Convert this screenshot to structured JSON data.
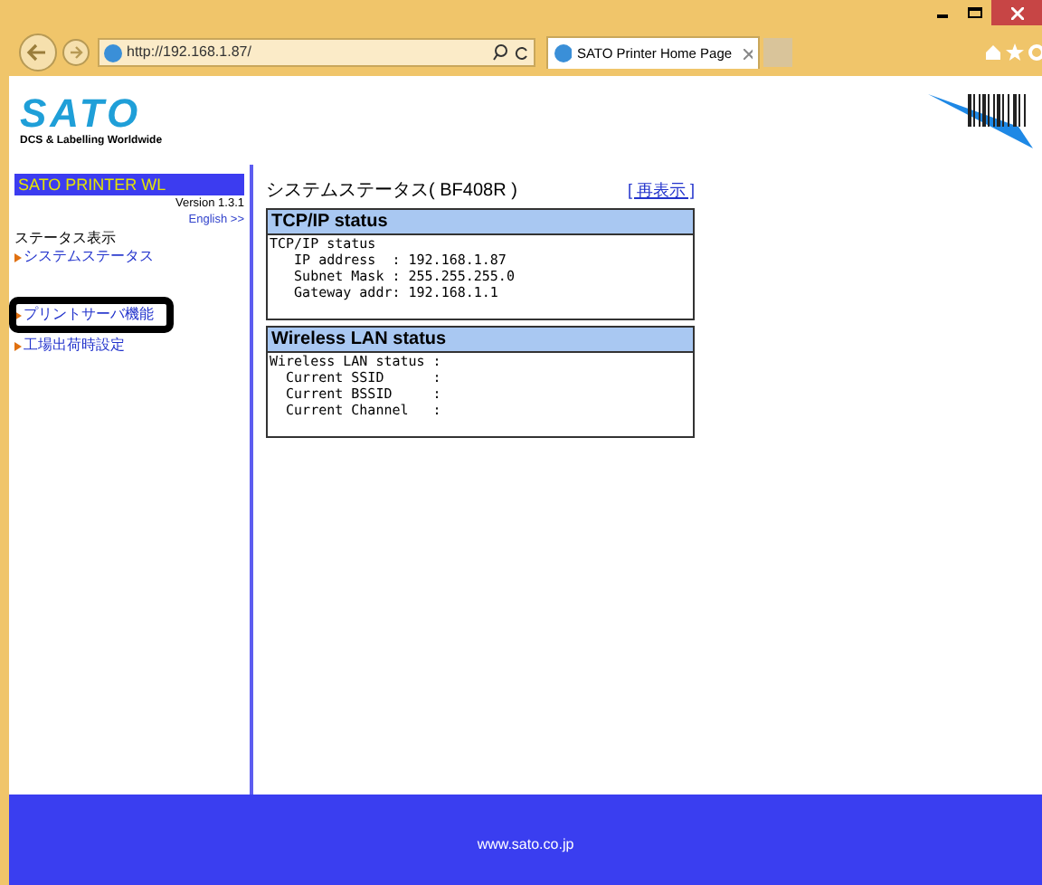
{
  "browser": {
    "address": "http://192.168.1.87/",
    "tabs": [
      {
        "title": "SATO Printer Home Page",
        "selected": true
      }
    ]
  },
  "header": {
    "logo_text": "SATO",
    "tagline": "DCS & Labelling Worldwide"
  },
  "sidebar": {
    "title": "SATO PRINTER WL",
    "version": "Version 1.3.1",
    "language_link": "English >>",
    "sections": [
      {
        "heading": "ステータス表示",
        "links": [
          {
            "label": "システムステータス",
            "highlighted": false
          }
        ]
      },
      {
        "links": [
          {
            "label": "プリントサーバ機能",
            "highlighted": true
          },
          {
            "label": "工場出荷時設定",
            "highlighted": false
          }
        ]
      }
    ]
  },
  "main": {
    "title": "システムステータス( BF408R )",
    "refresh_link": "[ 再表示 ]",
    "panels": [
      {
        "title": "TCP/IP status",
        "lines": [
          "TCP/IP status",
          "   IP address  : 192.168.1.87",
          "   Subnet Mask : 255.255.255.0",
          "   Gateway addr: 192.168.1.1"
        ]
      },
      {
        "title": "Wireless LAN status",
        "lines": [
          "Wireless LAN status :",
          "  Current SSID      :",
          "  Current BSSID     :",
          "  Current Channel   :"
        ]
      }
    ]
  },
  "footer": {
    "url": "www.sato.co.jp"
  }
}
